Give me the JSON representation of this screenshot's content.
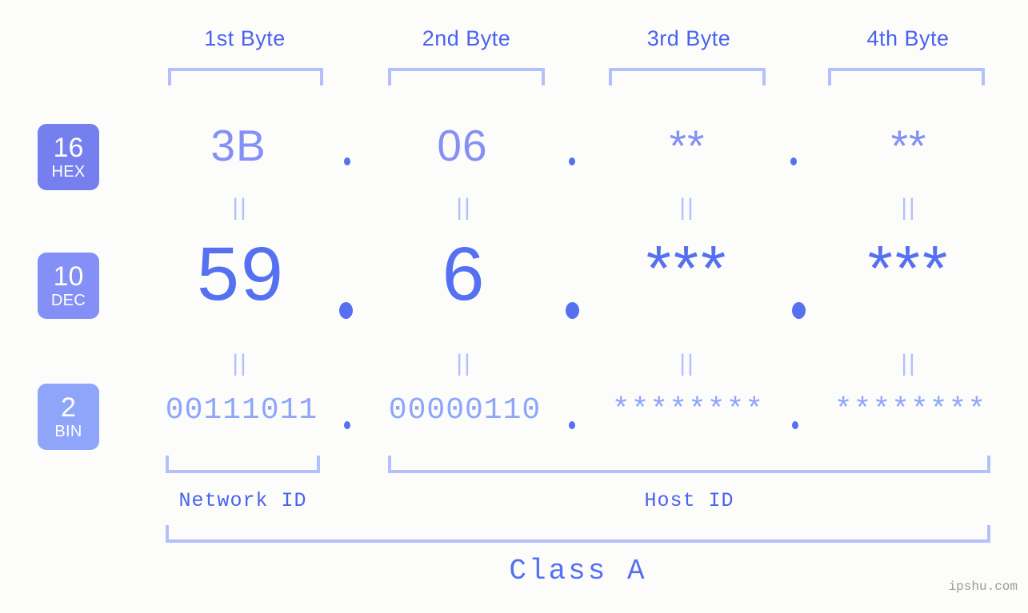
{
  "background_color": "#fcfdfa",
  "colors": {
    "accent_strong": "#4a62ee",
    "accent_mid": "#5570f0",
    "accent_light": "#8490f5",
    "accent_lighter": "#8ea5fa",
    "bracket": "#b4c0fb",
    "badge_hex": "#7580ee",
    "badge_dec": "#8490f5",
    "badge_bin": "#8ea5fa",
    "watermark": "#9a9a9a"
  },
  "byte_headers": [
    {
      "label": "1st Byte"
    },
    {
      "label": "2nd Byte"
    },
    {
      "label": "3rd Byte"
    },
    {
      "label": "4th Byte"
    }
  ],
  "rows": [
    {
      "badge_number": "16",
      "badge_abbr": "HEX",
      "values": [
        "3B",
        "06",
        "**",
        "**"
      ],
      "separator": "."
    },
    {
      "badge_number": "10",
      "badge_abbr": "DEC",
      "values": [
        "59",
        "6",
        "***",
        "***"
      ],
      "separator": "."
    },
    {
      "badge_number": "2",
      "badge_abbr": "BIN",
      "values": [
        "00111011",
        "00000110",
        "********",
        "********"
      ],
      "separator": "."
    }
  ],
  "connectors": {
    "symbol": "||"
  },
  "id_labels": {
    "network": "Network ID",
    "host": "Host ID"
  },
  "class_label": "Class A",
  "watermark": "ipshu.com"
}
